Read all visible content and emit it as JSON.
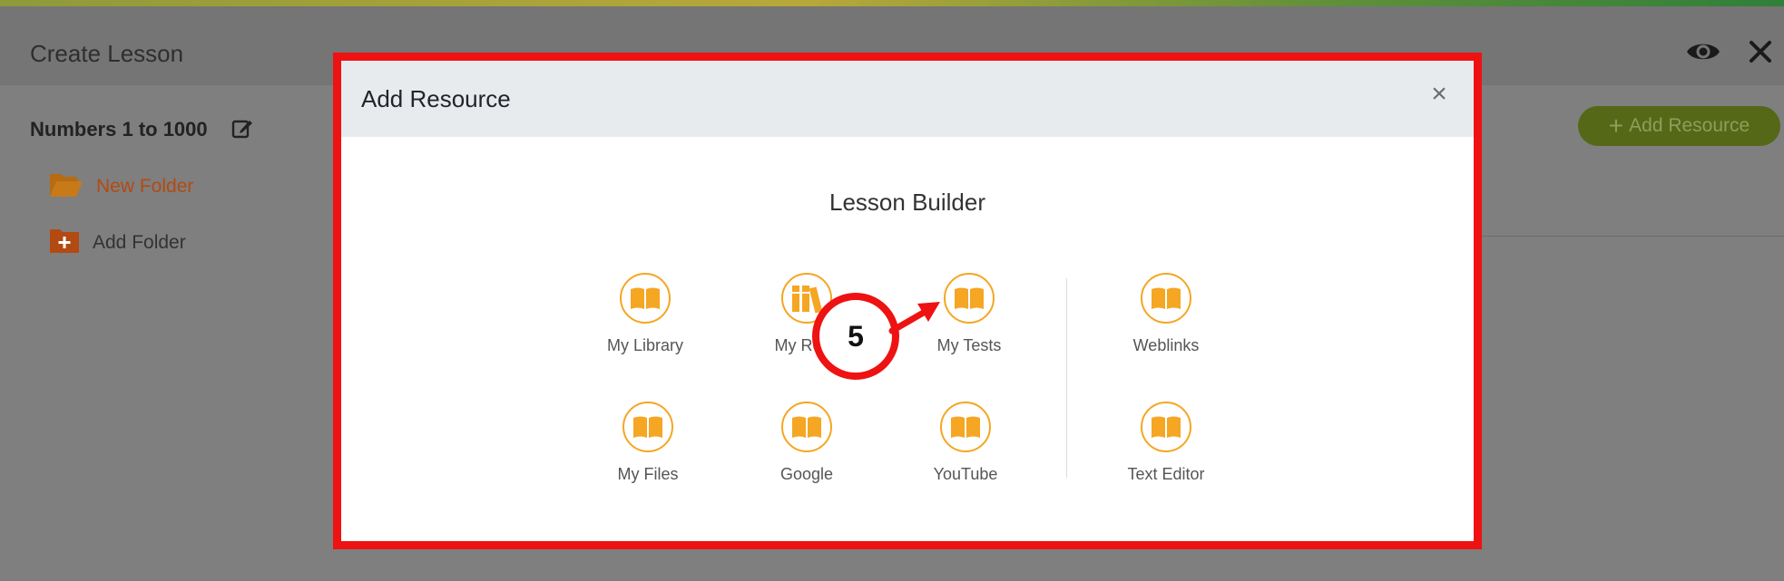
{
  "app": {
    "title": "Create Lesson",
    "header_icons": [
      "eye-icon",
      "close-icon"
    ],
    "lesson_name": "Numbers 1 to 1000",
    "folders": [
      {
        "label": "New Folder",
        "icon": "open-folder-icon",
        "color": "#b34a12"
      },
      {
        "label": "Add Folder",
        "icon": "add-folder-icon"
      }
    ],
    "add_resource_button": {
      "plus": "+",
      "label": "Add Resource"
    }
  },
  "modal": {
    "title": "Add Resource",
    "close_glyph": "×",
    "section_title": "Lesson Builder",
    "items": [
      {
        "label": "My Library",
        "icon": "book-icon"
      },
      {
        "label": "My Reso",
        "icon": "books-shelf-icon"
      },
      {
        "label": "My Tests",
        "icon": "book-icon"
      },
      {
        "label": "Weblinks",
        "icon": "book-icon"
      },
      {
        "label": "My Files",
        "icon": "book-icon"
      },
      {
        "label": "Google",
        "icon": "book-icon"
      },
      {
        "label": "YouTube",
        "icon": "book-icon"
      },
      {
        "label": "Text Editor",
        "icon": "book-icon"
      }
    ]
  },
  "annotation": {
    "step": "5"
  },
  "colors": {
    "accent_orange": "#f5a623",
    "highlight_red": "#ee1212",
    "add_button_green": "#556818"
  }
}
